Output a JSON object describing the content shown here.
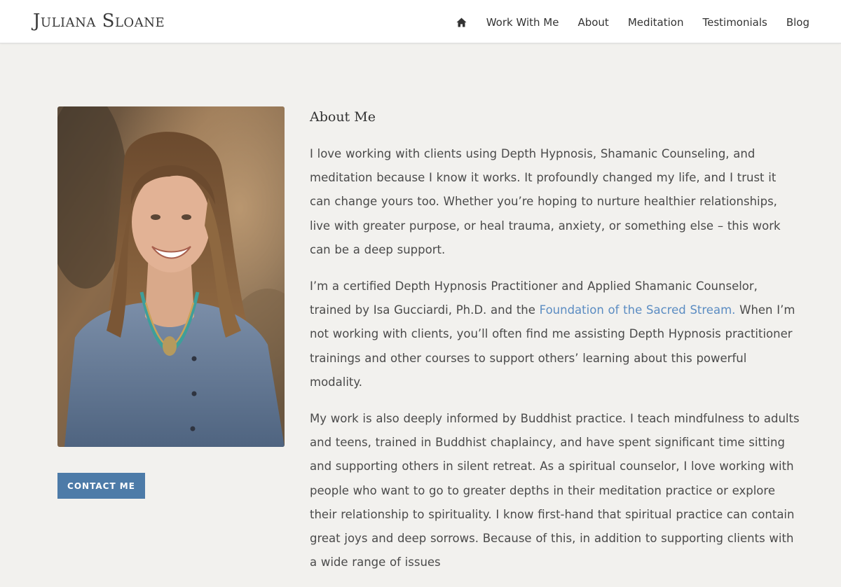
{
  "header": {
    "logo": "Juliana Sloane",
    "nav": {
      "home_icon": "home-icon",
      "items": [
        "Work With Me",
        "About",
        "Meditation",
        "Testimonials",
        "Blog"
      ]
    }
  },
  "sidebar": {
    "photo_alt": "Portrait of Juliana Sloane",
    "contact_label": "CONTACT ME"
  },
  "main": {
    "heading": "About Me",
    "para1": "I love working with clients using Depth Hypnosis, Shamanic Counseling, and meditation because I know it works. It profoundly changed my life, and I trust it can change yours too. Whether you’re hoping to nurture healthier relationships, live with greater purpose, or heal trauma, anxiety, or something else – this work can be a deep support.",
    "para2_before": "I’m a certified Depth Hypnosis Practitioner and Applied Shamanic Counselor, trained by Isa Gucciardi, Ph.D. and the ",
    "para2_link": "Foundation of the Sacred Stream.",
    "para2_after": " When I’m not working with clients, you’ll often find me assisting Depth Hypnosis practitioner trainings and other courses to support others’ learning about this powerful modality.",
    "para3": "My work is also deeply informed by Buddhist practice. I teach mindfulness to adults and teens, trained in Buddhist chaplaincy, and have spent significant time sitting and supporting others in silent retreat. As a spiritual counselor, I love working with people who want to go to greater depths in their meditation practice or explore their relationship to spirituality. I know first-hand that spiritual practice can contain great joys and deep sorrows. Because of this, in addition to supporting clients with a wide range of issues"
  },
  "colors": {
    "background": "#f2f1ee",
    "accent": "#4d7ba8",
    "link": "#5b8cc2",
    "text": "#4a4a4a"
  }
}
